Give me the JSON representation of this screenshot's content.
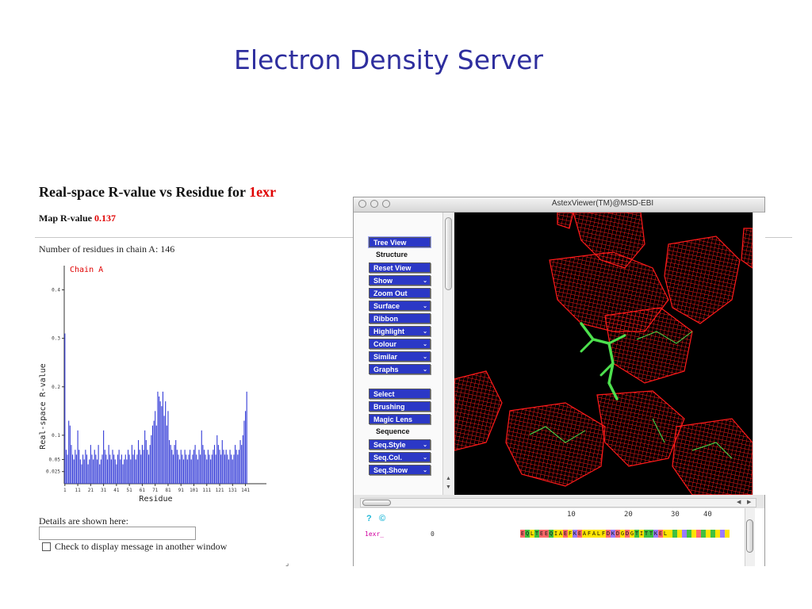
{
  "slide": {
    "title": "Electron Density Server"
  },
  "page": {
    "heading_prefix": "Real-space R-value vs Residue for",
    "pdb_id": "1exr",
    "map_r_label": "Map R-value",
    "map_r_value": "0.137",
    "num_residues_text": "Number of residues in chain A: 146",
    "details_label": "Details are shown here:",
    "details_value": "",
    "checkbox_label": "Check to display message in another window",
    "resize_mark": "⌟"
  },
  "chart_data": {
    "type": "bar",
    "legend": "Chain A",
    "xlabel": "Residue",
    "ylabel": "Real-space R-value",
    "ylim": [
      0,
      0.45
    ],
    "xlim": [
      1,
      146
    ],
    "yticks": [
      {
        "value": 0.025,
        "label": "0.025"
      },
      {
        "value": 0.05,
        "label": "0.05"
      },
      {
        "value": 0.1,
        "label": "0.1"
      },
      {
        "value": 0.2,
        "label": "0.2"
      },
      {
        "value": 0.3,
        "label": "0.3"
      },
      {
        "value": 0.4,
        "label": "0.4"
      }
    ],
    "xticks": [
      1,
      11,
      21,
      31,
      41,
      51,
      61,
      71,
      81,
      91,
      101,
      111,
      121,
      131,
      141
    ],
    "values": [
      0.31,
      0.07,
      0.06,
      0.13,
      0.12,
      0.08,
      0.06,
      0.05,
      0.07,
      0.06,
      0.11,
      0.07,
      0.05,
      0.04,
      0.06,
      0.05,
      0.07,
      0.06,
      0.04,
      0.05,
      0.08,
      0.06,
      0.05,
      0.07,
      0.06,
      0.05,
      0.08,
      0.04,
      0.05,
      0.06,
      0.11,
      0.07,
      0.06,
      0.05,
      0.08,
      0.06,
      0.05,
      0.07,
      0.06,
      0.05,
      0.04,
      0.06,
      0.07,
      0.05,
      0.06,
      0.04,
      0.05,
      0.06,
      0.05,
      0.07,
      0.06,
      0.05,
      0.08,
      0.06,
      0.07,
      0.05,
      0.06,
      0.09,
      0.07,
      0.06,
      0.08,
      0.07,
      0.11,
      0.09,
      0.07,
      0.06,
      0.08,
      0.1,
      0.12,
      0.13,
      0.15,
      0.12,
      0.19,
      0.18,
      0.17,
      0.16,
      0.19,
      0.14,
      0.17,
      0.12,
      0.15,
      0.09,
      0.08,
      0.07,
      0.06,
      0.08,
      0.09,
      0.07,
      0.06,
      0.05,
      0.07,
      0.06,
      0.05,
      0.07,
      0.06,
      0.05,
      0.06,
      0.07,
      0.05,
      0.06,
      0.07,
      0.08,
      0.06,
      0.05,
      0.07,
      0.06,
      0.11,
      0.08,
      0.07,
      0.06,
      0.05,
      0.07,
      0.06,
      0.05,
      0.06,
      0.07,
      0.08,
      0.06,
      0.1,
      0.08,
      0.07,
      0.06,
      0.09,
      0.07,
      0.06,
      0.07,
      0.06,
      0.05,
      0.07,
      0.06,
      0.05,
      0.06,
      0.08,
      0.07,
      0.06,
      0.07,
      0.09,
      0.08,
      0.1,
      0.13,
      0.15,
      0.19
    ]
  },
  "viewer": {
    "title": "AstexViewer(TM)@MSD-EBI",
    "buttons": {
      "tree_view": "Tree View",
      "reset_view": "Reset View",
      "show": "Show",
      "zoom_out": "Zoom Out",
      "surface": "Surface",
      "ribbon": "Ribbon",
      "highlight": "Highlight",
      "colour": "Colour",
      "similar": "Similar",
      "graphs": "Graphs",
      "select": "Select",
      "brushing": "Brushing",
      "magic_lens": "Magic Lens",
      "seq_style": "Seq.Style",
      "seq_col": "Seq.Col.",
      "seq_show": "Seq.Show"
    },
    "labels": {
      "structure": "Structure",
      "sequence": "Sequence"
    },
    "dropdown_arrow": "⌄",
    "scroll_up": "▲",
    "scroll_down": "▼",
    "scroll_left": "◀",
    "scroll_right": "▶",
    "map_color": "#ff1a1a",
    "bond_color": "#4de04d"
  },
  "sequence": {
    "help_icon": "?",
    "copyright_icon": "©",
    "ruler": [
      "10",
      "20",
      "30",
      "40"
    ],
    "chain": "1exr_",
    "start": "0",
    "residues": "EQLTEEQIAEFKEAFALFDKDGDGTITTKEL",
    "tail_colors": [
      "#ffe400",
      "#40c040",
      "#ffe400",
      "#9a7bff",
      "#40c040",
      "#ffe400",
      "#ff6a6a",
      "#40c040",
      "#ffe400",
      "#40c040",
      "#ffe400",
      "#9a7bff",
      "#ffe400"
    ]
  }
}
